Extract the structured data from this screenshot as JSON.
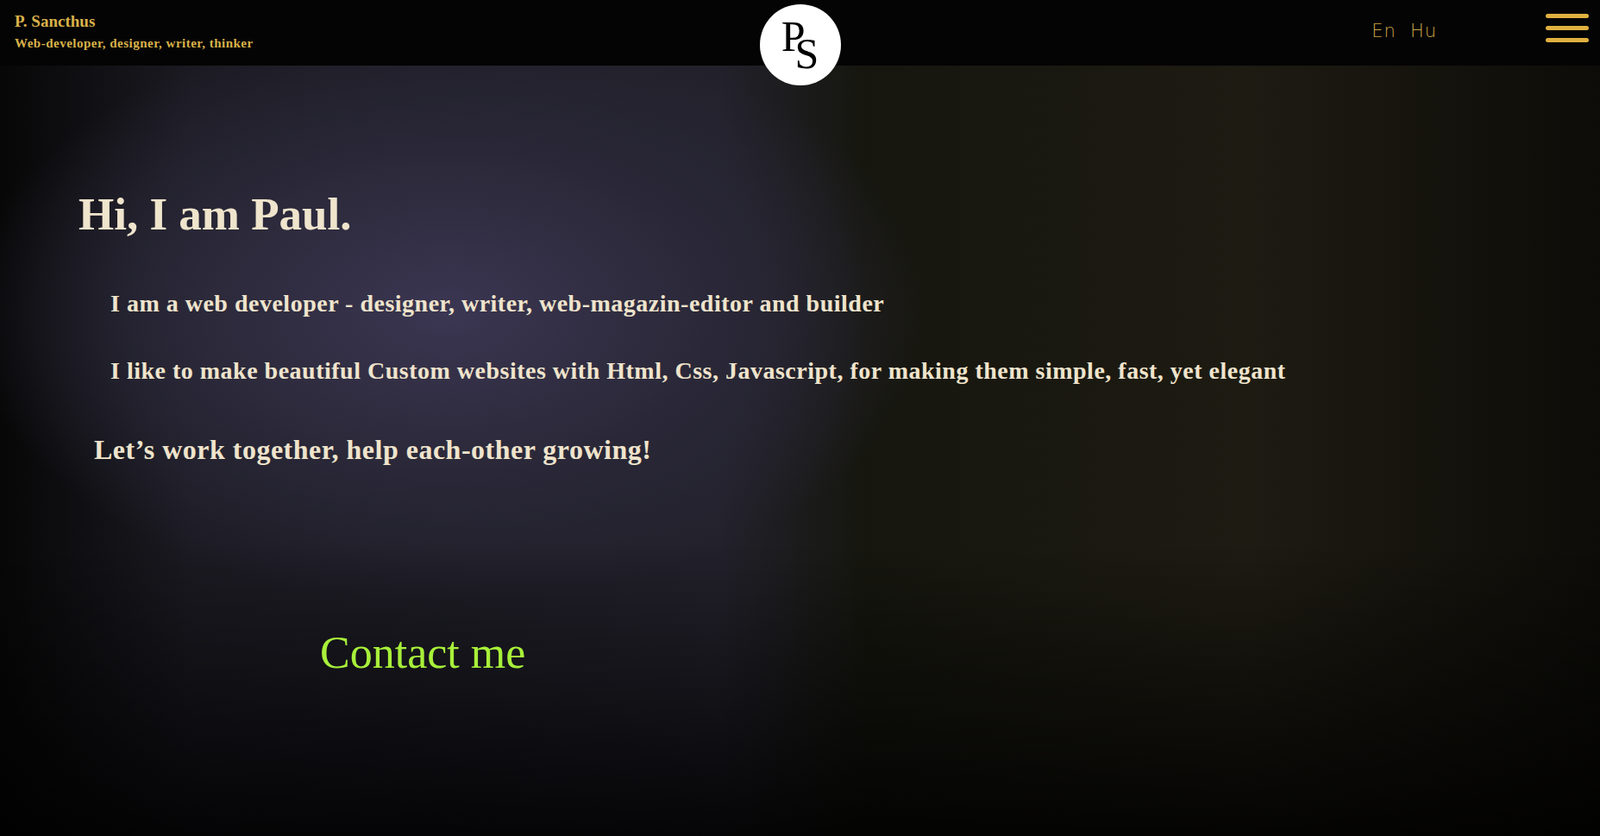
{
  "header": {
    "name": "P. Sancthus",
    "tagline": "Web-developer, designer, writer, thinker",
    "logo": [
      "P",
      "S"
    ],
    "languages": [
      "En",
      "Hu"
    ]
  },
  "hero": {
    "title": "Hi, I am Paul.",
    "lines": [
      "I am a web developer - designer, writer, web-magazin-editor and builder",
      "I like to make beautiful Custom websites with Html, Css, Javascript, for making them simple, fast, yet elegant"
    ],
    "call": "Let’s work together, help each-other growing!",
    "contact": "Contact me"
  }
}
